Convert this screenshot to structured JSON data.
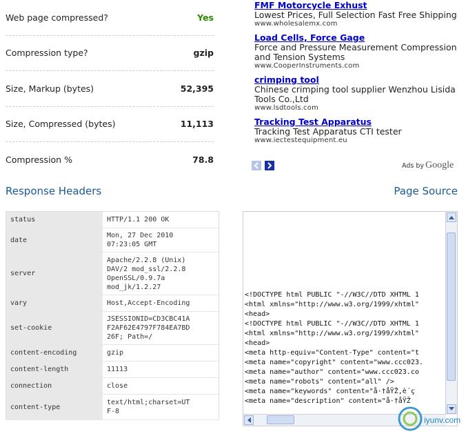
{
  "stats": [
    {
      "label": "Web page compressed?",
      "value": "Yes"
    },
    {
      "label": "Compression type?",
      "value": "gzip"
    },
    {
      "label": "Size, Markup (bytes)",
      "value": "52,395"
    },
    {
      "label": "Size, Compressed (bytes)",
      "value": "11,113"
    },
    {
      "label": "Compression %",
      "value": "78.8"
    }
  ],
  "ads": [
    {
      "title": "FMF Motorcycle Exhust",
      "desc": "Lowest Prices, Full Selection Fast Free Shipping",
      "url": "www.wholesalemx.com"
    },
    {
      "title": "Load Cells, Force Gage",
      "desc": "Force and Pressure Measurement Compression and Tension Systems",
      "url": "www.CooperInstruments.com"
    },
    {
      "title": "crimping tool",
      "desc": "Chinese crimping tool supplier Wenzhou Lisida Tools Co.,Ltd",
      "url": "www.lsdtools.com"
    },
    {
      "title": "Tracking Test Apparatus",
      "desc": "Tracking Test Apparatus CTI tester",
      "url": "www.iectestequipment.eu"
    }
  ],
  "ads_by": {
    "prefix": "Ads by",
    "brand": "Google"
  },
  "headings": {
    "response_headers": "Response Headers",
    "page_source": "Page Source"
  },
  "headers": [
    {
      "key": "status",
      "value": "HTTP/1.1 200 OK"
    },
    {
      "key": "date",
      "value": "Mon, 27 Dec 2010\n07:23:05 GMT"
    },
    {
      "key": "server",
      "value": "Apache/2.2.8 (Unix)\nDAV/2 mod_ssl/2.2.8\nOpenSSL/0.9.7a\nmod_jk/1.2.27"
    },
    {
      "key": "vary",
      "value": "Host,Accept-Encoding"
    },
    {
      "key": "set-cookie",
      "value": "JSESSIONID=CD3CBC41A\nF2AF62E4797F784EA7BD\n26F; Path=/"
    },
    {
      "key": "content-encoding",
      "value": "gzip"
    },
    {
      "key": "content-length",
      "value": "11113"
    },
    {
      "key": "connection",
      "value": "close"
    },
    {
      "key": "content-type",
      "value": "text/html;charset=UT\nF-8"
    }
  ],
  "source_lines": [
    "<!DOCTYPE html PUBLIC \"-//W3C//DTD XHTML 1",
    "<html xmlns=\"http://www.w3.org/1999/xhtml\"",
    "<head>",
    "",
    "<!DOCTYPE html PUBLIC \"-//W3C//DTD XHTML 1",
    "<html xmlns=\"http://www.w3.org/1999/xhtml\"",
    "<head>",
    "<meta http-equiv=\"Content-Type\" content=\"t",
    "<meta name=\"copyright\" content=\"www.ccc023.",
    "<meta name=\"author\" content=\"www.ccc023.co",
    "<meta name=\"robots\" content=\"all\" />",
    "<meta name=\"keywords\" content=\"å·†åŸŽ,è´ç",
    "<meta name=\"description\" content=\"å·†åŸŽ"
  ],
  "watermark": {
    "text": "iyunv.com"
  },
  "colors": {
    "accent": "#1a5a8f",
    "link": "#0000cc",
    "yes": "#2b8a00"
  }
}
